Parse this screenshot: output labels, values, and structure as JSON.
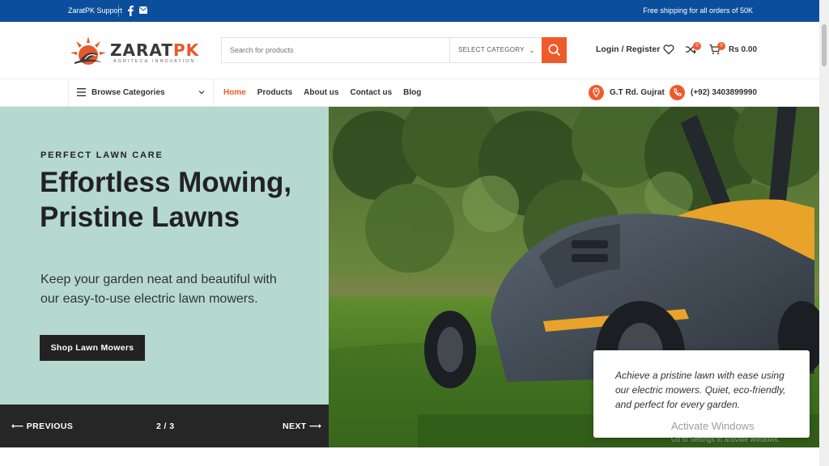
{
  "topbar": {
    "support_label": "ZaratPK Support",
    "shipping_text": "Free shipping for all orders of 50K"
  },
  "header": {
    "logo": {
      "name_main": "ZARAT",
      "name_accent": "PK",
      "tagline": "AGRITECH INNOVATION"
    },
    "search": {
      "placeholder": "Search for products",
      "category_label": "SELECT CATEGORY"
    },
    "login_label": "Login / Register",
    "compare_count": "0",
    "cart_count": "0",
    "cart_total": "Rs 0.00"
  },
  "nav": {
    "browse_label": "Browse Categories",
    "menu": [
      {
        "label": "Home",
        "active": true
      },
      {
        "label": "Products"
      },
      {
        "label": "About us"
      },
      {
        "label": "Contact us"
      },
      {
        "label": "Blog"
      }
    ],
    "location": "G.T Rd. Gujrat",
    "phone": "(+92) 3403899990"
  },
  "hero": {
    "eyebrow": "PERFECT LAWN CARE",
    "title": "Effortless Mowing, Pristine Lawns",
    "description": "Keep your garden neat and beautiful with our easy-to-use electric lawn mowers.",
    "cta_label": "Shop Lawn Mowers",
    "quote": "Achieve a pristine lawn with ease using our electric mowers. Quiet, eco-friendly, and perfect for every garden."
  },
  "slider": {
    "prev_label": "PREVIOUS",
    "counter": "2 / 3",
    "next_label": "NEXT"
  },
  "watermark": {
    "title": "Activate Windows",
    "subtitle": "Go to Settings to activate Windows."
  },
  "colors": {
    "topbar": "#0b4f9c",
    "accent": "#ef5a2b",
    "hero_bg": "#b6d9cf",
    "dark": "#262626"
  },
  "icons": [
    "facebook-icon",
    "mail-icon",
    "search-icon",
    "heart-icon",
    "compare-icon",
    "cart-icon",
    "menu-icon",
    "location-icon",
    "phone-icon",
    "arrow-left-icon",
    "arrow-right-icon"
  ]
}
